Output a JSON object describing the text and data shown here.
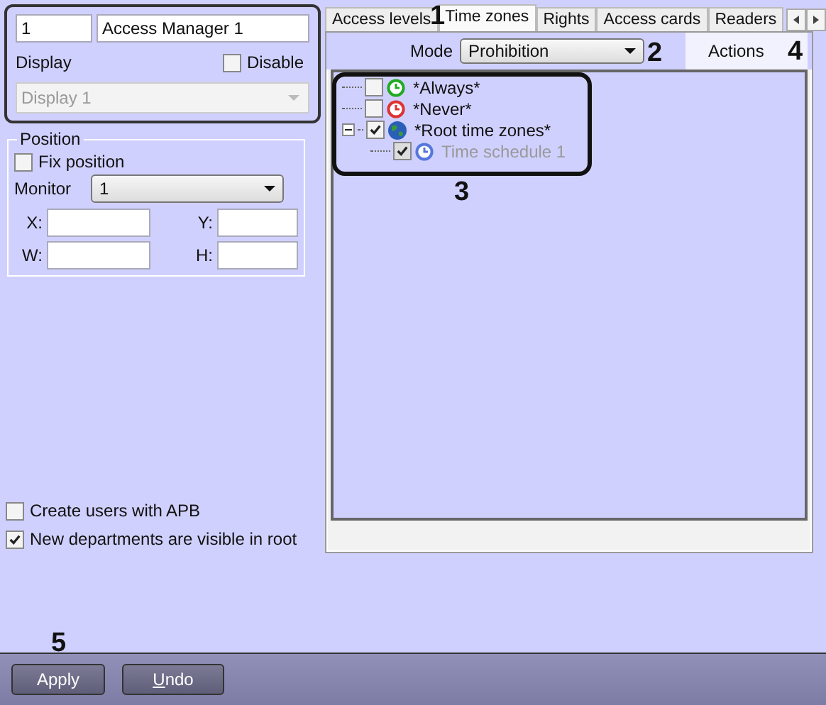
{
  "device": {
    "id": "1",
    "name": "Access Manager 1",
    "display_label": "Display",
    "disable": {
      "label": "Disable",
      "checked": false
    },
    "display_select": {
      "value": "Display 1",
      "disabled": true
    }
  },
  "position": {
    "title": "Position",
    "fix_position": {
      "label": "Fix position",
      "checked": false
    },
    "monitor_label": "Monitor",
    "monitor": "1",
    "fields": [
      {
        "label": "X:"
      },
      {
        "label": "Y:"
      },
      {
        "label": "W:"
      },
      {
        "label": "H:"
      }
    ]
  },
  "options": [
    {
      "label": "Create users with APB",
      "checked": false
    },
    {
      "label": "New departments are visible in root",
      "checked": true
    }
  ],
  "tabs": [
    {
      "label": "Access levels",
      "selected": false
    },
    {
      "label": "Time zones",
      "selected": true
    },
    {
      "label": "Rights",
      "selected": false
    },
    {
      "label": "Access cards",
      "selected": false
    },
    {
      "label": "Readers",
      "selected": false
    }
  ],
  "mode": {
    "label": "Mode",
    "value": "Prohibition"
  },
  "actions": "Actions",
  "tree": [
    {
      "label": "*Always*",
      "checked": false,
      "kind": "clock",
      "color": "#22aa22",
      "disabled": false
    },
    {
      "label": "*Never*",
      "checked": false,
      "kind": "clock",
      "color": "#dd3333",
      "disabled": false
    },
    {
      "label": "*Root time zones*",
      "checked": true,
      "kind": "globe",
      "disabled": false,
      "expanded": true,
      "children": [
        {
          "label": "Time schedule 1",
          "checked": true,
          "kind": "clock",
          "color": "#5577dd",
          "disabled": true
        }
      ]
    }
  ],
  "annotations": [
    "1",
    "2",
    "3",
    "4",
    "5"
  ],
  "buttons": [
    {
      "label": "Apply"
    },
    {
      "label": "Undo",
      "mnemonic_first": true
    }
  ]
}
